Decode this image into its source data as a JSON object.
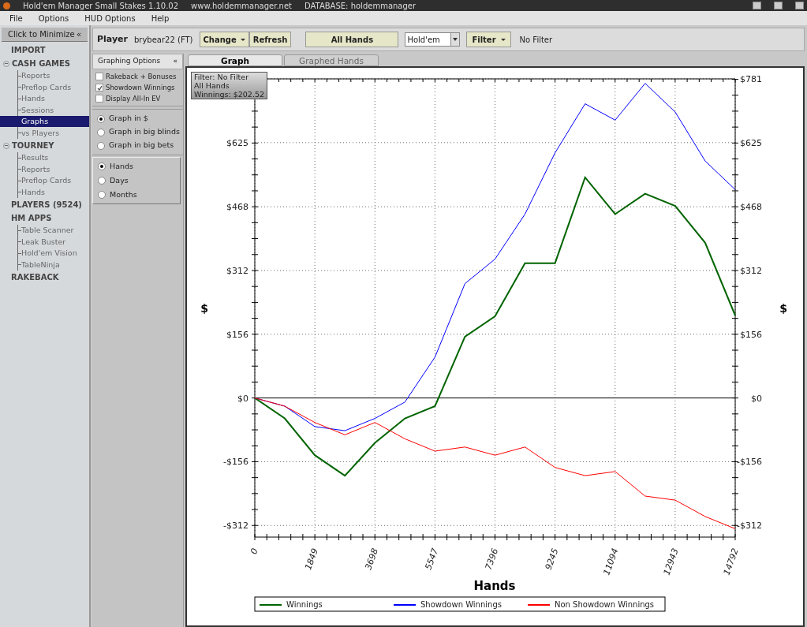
{
  "window": {
    "title": "Hold'em Manager Small Stakes 1.10.02",
    "url": "www.holdemmanager.net",
    "database": "DATABASE: holdemmanager"
  },
  "menu": [
    "File",
    "Options",
    "HUD Options",
    "Help"
  ],
  "sidebar": {
    "minimize": "Click to Minimize",
    "collapse_icon": "«",
    "items": [
      {
        "label": "IMPORT",
        "selected": false
      },
      {
        "label": "CASH GAMES",
        "selected": false,
        "expanded": true,
        "children": [
          {
            "label": "Reports",
            "selected": false
          },
          {
            "label": "Preflop Cards",
            "selected": false
          },
          {
            "label": "Hands",
            "selected": false
          },
          {
            "label": "Sessions",
            "selected": false
          },
          {
            "label": "Graphs",
            "selected": true
          },
          {
            "label": "vs Players",
            "selected": false
          }
        ]
      },
      {
        "label": "TOURNEY",
        "selected": false,
        "expanded": true,
        "children": [
          {
            "label": "Results",
            "selected": false
          },
          {
            "label": "Reports",
            "selected": false
          },
          {
            "label": "Preflop Cards",
            "selected": false
          },
          {
            "label": "Hands",
            "selected": false
          }
        ]
      },
      {
        "label": "PLAYERS (9524)",
        "selected": false
      },
      {
        "label": "HM APPS",
        "selected": false,
        "children": [
          {
            "label": "Table Scanner",
            "selected": false
          },
          {
            "label": "Leak Buster",
            "selected": false
          },
          {
            "label": "Hold'em Vision",
            "selected": false
          },
          {
            "label": "TableNinja",
            "selected": false
          }
        ]
      },
      {
        "label": "RAKEBACK",
        "selected": false
      }
    ]
  },
  "toolbar": {
    "player_label": "Player",
    "player": "brybear22 (FT)",
    "change": "Change",
    "refresh": "Refresh",
    "all_hands": "All Hands",
    "game": "Hold'em",
    "filter": "Filter",
    "filter_status": "No Filter"
  },
  "options": {
    "title": "Graphing Options",
    "collapse_icon": "«",
    "checkboxes": [
      {
        "label": "Rakeback + Bonuses",
        "checked": false
      },
      {
        "label": "Showdown Winnings",
        "checked": true
      },
      {
        "label": "Display All-In EV",
        "checked": false
      }
    ],
    "units": [
      {
        "label": "Graph in $",
        "selected": true
      },
      {
        "label": "Graph in big blinds",
        "selected": false
      },
      {
        "label": "Graph in big bets",
        "selected": false
      }
    ],
    "period": [
      {
        "label": "Hands",
        "selected": true
      },
      {
        "label": "Days",
        "selected": false
      },
      {
        "label": "Months",
        "selected": false
      }
    ]
  },
  "tabs": [
    {
      "label": "Graph",
      "selected": true
    },
    {
      "label": "Graphed Hands",
      "selected": false
    }
  ],
  "info_box": [
    "Filter: No Filter",
    "All Hands",
    "Winnings: $202.52"
  ],
  "chart_data": {
    "type": "line",
    "xlabel": "Hands",
    "ylabel": "$",
    "grid": true,
    "legend": true,
    "x": [
      0,
      924,
      1849,
      2773,
      3698,
      4622,
      5547,
      6471,
      7396,
      8320,
      9245,
      10169,
      11094,
      12018,
      12943,
      13867,
      14792
    ],
    "series": [
      {
        "name": "Winnings",
        "color": "#006400",
        "values": [
          0,
          -50,
          -140,
          -190,
          -110,
          -50,
          -20,
          150,
          200,
          330,
          330,
          540,
          450,
          500,
          470,
          380,
          202
        ]
      },
      {
        "name": "Showdown Winnings",
        "color": "#0000ff",
        "values": [
          0,
          -20,
          -70,
          -80,
          -50,
          -10,
          100,
          280,
          340,
          450,
          600,
          720,
          680,
          770,
          700,
          580,
          510
        ]
      },
      {
        "name": "Non Showdown Winnings",
        "color": "#ff0000",
        "values": [
          0,
          -20,
          -60,
          -90,
          -60,
          -100,
          -130,
          -120,
          -140,
          -120,
          -170,
          -190,
          -180,
          -240,
          -250,
          -290,
          -320
        ]
      }
    ],
    "xlim": [
      0,
      14792
    ],
    "ylim": [
      -325,
      781
    ],
    "xticks": [
      0,
      1849,
      3698,
      5547,
      7396,
      9245,
      11094,
      12943,
      14792
    ],
    "yticks": [
      {
        "value": -312,
        "label": "-$312"
      },
      {
        "value": -156,
        "label": "-$156"
      },
      {
        "value": 0,
        "label": "$0"
      },
      {
        "value": 156,
        "label": "$156"
      },
      {
        "value": 312,
        "label": "$312"
      },
      {
        "value": 468,
        "label": "$468"
      },
      {
        "value": 625,
        "label": "$625"
      },
      {
        "value": 781,
        "label": "$781"
      }
    ]
  }
}
